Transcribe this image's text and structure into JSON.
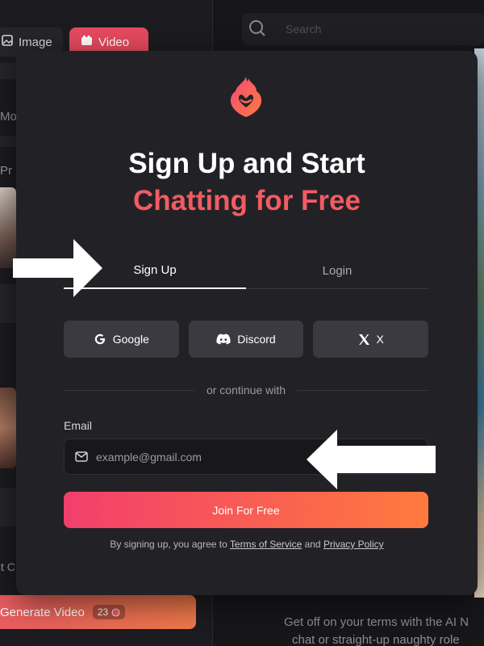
{
  "background": {
    "tabs": {
      "image_label": "Image",
      "video_label": "Video"
    },
    "side_texts": [
      "Mo",
      "Pr",
      "ct C"
    ],
    "search_placeholder": "Search",
    "generate": {
      "label": "Generate Video",
      "credits": "23"
    },
    "footer_text": [
      "Get off on your terms with the AI N",
      "chat or straight-up naughty role"
    ]
  },
  "modal": {
    "title_line1": "Sign Up and Start",
    "title_line2": "Chatting for Free",
    "tabs": {
      "signup": "Sign Up",
      "login": "Login"
    },
    "social": {
      "google": "Google",
      "discord": "Discord",
      "x": "X"
    },
    "divider": "or continue with",
    "email": {
      "label": "Email",
      "placeholder": "example@gmail.com",
      "value": ""
    },
    "join_button": "Join For Free",
    "terms": {
      "prefix": "By signing up, you agree to ",
      "tos": "Terms of Service",
      "and": " and ",
      "privacy": "Privacy Policy"
    }
  },
  "colors": {
    "accent": "#f25b62",
    "join_gradient_start": "#f23f6c",
    "join_gradient_end": "#ff7a3d",
    "modal_bg": "#222226"
  },
  "icons": [
    "flame-heart-logo-icon",
    "google-icon",
    "discord-icon",
    "x-icon",
    "mail-icon",
    "search-icon",
    "image-icon",
    "video-icon",
    "arrow-right-icon",
    "arrow-left-icon"
  ]
}
